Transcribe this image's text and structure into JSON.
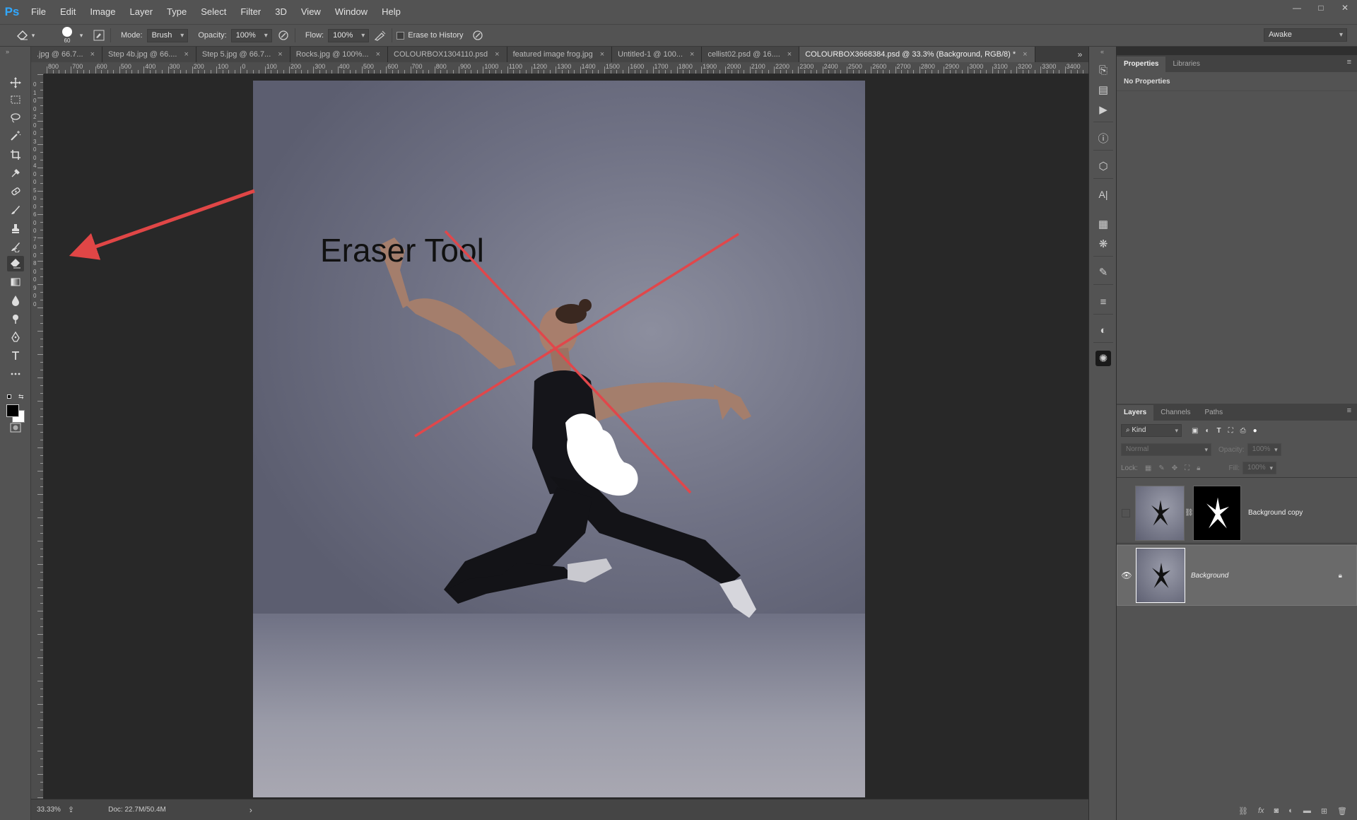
{
  "app": {
    "logo": "Ps"
  },
  "menu": [
    "File",
    "Edit",
    "Image",
    "Layer",
    "Type",
    "Select",
    "Filter",
    "3D",
    "View",
    "Window",
    "Help"
  ],
  "window_controls": [
    "—",
    "□",
    "✕"
  ],
  "options_bar": {
    "brush_size": "60",
    "mode_label": "Mode:",
    "mode_value": "Brush",
    "opacity_label": "Opacity:",
    "opacity_value": "100%",
    "flow_label": "Flow:",
    "flow_value": "100%",
    "erase_to_history_label": "Erase to History",
    "workspace_value": "Awake"
  },
  "tabs": [
    {
      "label": ".jpg @ 66.7...",
      "active": false
    },
    {
      "label": "Step 4b.jpg @ 66....",
      "active": false
    },
    {
      "label": "Step 5.jpg @ 66.7...",
      "active": false
    },
    {
      "label": "Rocks.jpg @ 100%...",
      "active": false
    },
    {
      "label": "COLOURBOX1304110.psd",
      "active": false
    },
    {
      "label": "featured image frog.jpg",
      "active": false
    },
    {
      "label": "Untitled-1 @ 100...",
      "active": false
    },
    {
      "label": "cellist02.psd @ 16....",
      "active": false
    },
    {
      "label": "COLOURBOX3668384.psd @ 33.3% (Background, RGB/8) *",
      "active": true
    }
  ],
  "tab_close": "×",
  "tab_overflow": "»",
  "ruler": {
    "h_labels": [
      "800",
      "700",
      "600",
      "500",
      "400",
      "300",
      "200",
      "100",
      "0",
      "100",
      "200",
      "300",
      "400",
      "500",
      "600",
      "700",
      "800",
      "900",
      "1000",
      "1100",
      "1200",
      "1300",
      "1400",
      "1500",
      "1600",
      "1700",
      "1800",
      "1900",
      "2000",
      "2100",
      "2200",
      "2300",
      "2400",
      "2500",
      "2600",
      "2700",
      "2800",
      "2900",
      "3000",
      "3100",
      "3200",
      "3300",
      "3400"
    ],
    "v_labels": [
      "0",
      "1",
      "0",
      "0",
      "2",
      "0",
      "0",
      "3",
      "0",
      "0",
      "4",
      "0",
      "0",
      "5",
      "0",
      "0",
      "6",
      "0",
      "0",
      "7",
      "0",
      "0",
      "8",
      "0",
      "0",
      "9",
      "0",
      "0"
    ]
  },
  "canvas": {
    "annotation_text": "Eraser Tool",
    "colors": {
      "arrow": "#e04646",
      "cross": "#e0474b",
      "erased": "#ffffff"
    }
  },
  "status": {
    "zoom": "33.33%",
    "doc": "Doc: 22.7M/50.4M",
    "arrow": "›"
  },
  "properties_panel": {
    "tabs": [
      "Properties",
      "Libraries"
    ],
    "empty_text": "No Properties"
  },
  "layers_panel": {
    "tabs": [
      "Layers",
      "Channels",
      "Paths"
    ],
    "filter_kind": "Kind",
    "blend_mode": "Normal",
    "opacity_label": "Opacity:",
    "opacity_value": "100%",
    "lock_label": "Lock:",
    "fill_label": "Fill:",
    "fill_value": "100%",
    "layers": [
      {
        "name": "Background copy",
        "visible": false,
        "has_mask": true,
        "locked": false,
        "selected": false
      },
      {
        "name": "Background",
        "visible": true,
        "has_mask": false,
        "locked": true,
        "selected": true
      }
    ]
  },
  "tools": [
    "move-tool",
    "marquee-tool",
    "lasso-tool",
    "magic-wand-tool",
    "crop-tool",
    "eyedropper-tool",
    "healing-brush-tool",
    "brush-tool",
    "clone-stamp-tool",
    "history-brush-tool",
    "eraser-tool",
    "gradient-tool",
    "blur-tool",
    "dodge-tool",
    "pen-tool",
    "type-tool",
    "more-tools"
  ],
  "active_tool": "eraser-tool"
}
